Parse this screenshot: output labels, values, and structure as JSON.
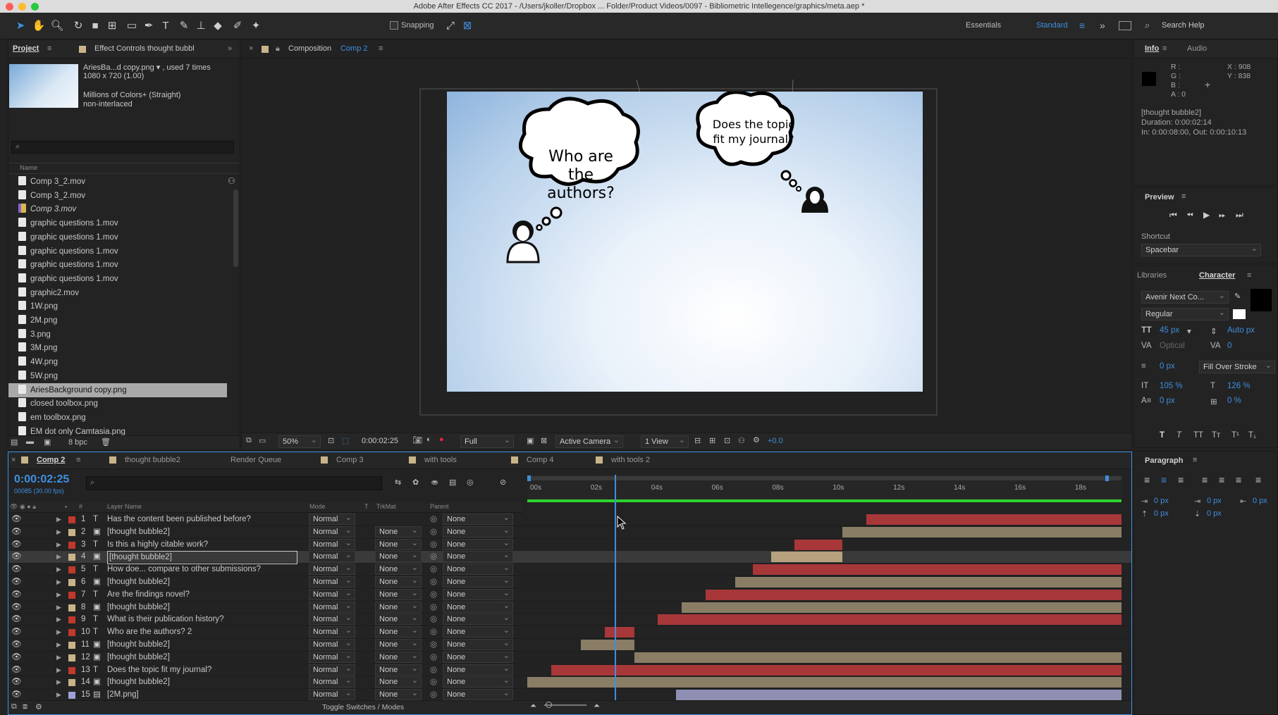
{
  "titlebar": {
    "title": "Adobe After Effects CC 2017 - /Users/jkoller/Dropbox ... Folder/Product Videos/0097 - Bibliometric Intellegence/graphics/meta.aep *"
  },
  "toolbar": {
    "snapping_label": "Snapping",
    "workspaces": [
      "Essentials",
      "Standard"
    ],
    "search_placeholder": "Search Help"
  },
  "project": {
    "tabs": [
      "Project",
      "Effect Controls thought bubbl"
    ],
    "preview_name": "AriesBa...d copy.png ▾ , used 7 times",
    "preview_size": "1080 x 720 (1.00)",
    "preview_colors": "Millions of Colors+ (Straight)",
    "preview_interlace": "non-interlaced",
    "name_header": "Name",
    "items": [
      "Comp 3_2.mov",
      "Comp 3_2.mov",
      "Comp 3.mov",
      "graphic questions 1.mov",
      "graphic questions 1.mov",
      "graphic questions 1.mov",
      "graphic questions 1.mov",
      "graphic questions 1.mov",
      "graphic2.mov",
      "1W.png",
      "2M.png",
      "3.png",
      "3M.png",
      "4W.png",
      "5W.png",
      "AriesBackground copy.png",
      "closed toolbox.png",
      "em toolbox.png",
      "EM dot only Camtasia.png"
    ],
    "bpc": "8 bpc"
  },
  "composition": {
    "tab_prefix": "Composition",
    "tab_name": "Comp 2",
    "bubble1": "Who are the authors?",
    "bubble2": "Does the topic fit my journal?",
    "zoom": "50%",
    "timecode": "0:00:02:25",
    "resolution": "Full",
    "camera": "Active Camera",
    "views": "1 View",
    "exposure": "+0.0"
  },
  "info": {
    "tabs": [
      "Info",
      "Audio"
    ],
    "r": "R :",
    "g": "G :",
    "b": "B :",
    "a": "A : 0",
    "x": "X : 908",
    "y": "Y : 838",
    "layer": "[thought bubble2]",
    "duration": "Duration: 0:00:02:14",
    "inout": "In: 0:00:08:00, Out: 0:00:10:13"
  },
  "preview": {
    "title": "Preview",
    "shortcut_label": "Shortcut",
    "shortcut_value": "Spacebar"
  },
  "character": {
    "tabs": [
      "Libraries",
      "Character"
    ],
    "font": "Avenir Next Co...",
    "style": "Regular",
    "size": "45 px",
    "leading": "Auto px",
    "kerning": "Optical",
    "tracking": "0",
    "stroke": "0 px",
    "stroke_mode": "Fill Over Stroke",
    "vscale": "105 %",
    "hscale": "126 %",
    "baseline": "0 px",
    "tsume": "0 %"
  },
  "paragraph": {
    "title": "Paragraph",
    "indent_values": [
      "0 px",
      "0 px",
      "0 px",
      "0 px",
      "0 px"
    ]
  },
  "timeline": {
    "tabs": [
      "Comp 2",
      "thought bubble2",
      "Render Queue",
      "Comp 3",
      "with tools",
      "Comp 4",
      "with tools 2"
    ],
    "timecode": "0:00:02:25",
    "frames": "00085 (30.00 fps)",
    "col_layer_name": "Layer Name",
    "col_mode": "Mode",
    "col_t": "T",
    "col_trkmat": "TrkMat",
    "col_parent": "Parent",
    "ruler": [
      "00s",
      "02s",
      "04s",
      "06s",
      "08s",
      "10s",
      "12s",
      "14s",
      "16s",
      "18s"
    ],
    "current_time_fraction": 0.15,
    "footer": "Toggle Switches / Modes",
    "layers": [
      {
        "num": "1",
        "name": "Has the content been published before?",
        "type": "T",
        "label": "#c0392b",
        "bar": "#a8373a",
        "start": 0.57,
        "end": 1.0
      },
      {
        "num": "2",
        "name": "[thought bubble2]",
        "type": "img",
        "label": "#c9b48a",
        "bar": "#8a7d66",
        "start": 0.53,
        "end": 1.0
      },
      {
        "num": "3",
        "name": "Is this a highly citable  work?",
        "type": "T",
        "label": "#c0392b",
        "bar": "#a8373a",
        "start": 0.45,
        "end": 0.53
      },
      {
        "num": "4",
        "name": "[thought bubble2]",
        "type": "img",
        "label": "#c9b48a",
        "bar": "#b5a17d",
        "start": 0.41,
        "end": 0.53
      },
      {
        "num": "5",
        "name": "How doe... compare to other  submissions?",
        "type": "T",
        "label": "#c0392b",
        "bar": "#a8373a",
        "start": 0.38,
        "end": 1.0
      },
      {
        "num": "6",
        "name": "[thought bubble2]",
        "type": "img",
        "label": "#c9b48a",
        "bar": "#8a7d66",
        "start": 0.35,
        "end": 1.0
      },
      {
        "num": "7",
        "name": "Are the findings novel?",
        "type": "T",
        "label": "#c0392b",
        "bar": "#a8373a",
        "start": 0.3,
        "end": 1.0
      },
      {
        "num": "8",
        "name": "[thought bubble2]",
        "type": "img",
        "label": "#c9b48a",
        "bar": "#8a7d66",
        "start": 0.26,
        "end": 1.0
      },
      {
        "num": "9",
        "name": "What is their publication history?",
        "type": "T",
        "label": "#c0392b",
        "bar": "#a8373a",
        "start": 0.22,
        "end": 1.0
      },
      {
        "num": "10",
        "name": "Who are  the authors? 2",
        "type": "T",
        "label": "#c0392b",
        "bar": "#a8373a",
        "start": 0.13,
        "end": 0.18
      },
      {
        "num": "11",
        "name": "[thought bubble2]",
        "type": "img",
        "label": "#c9b48a",
        "bar": "#8a7d66",
        "start": 0.09,
        "end": 0.18
      },
      {
        "num": "12",
        "name": "[thought bubble2]",
        "type": "img",
        "label": "#c9b48a",
        "bar": "#8a7d66",
        "start": 0.18,
        "end": 1.0
      },
      {
        "num": "13",
        "name": "Does the  topic fit  my journal?",
        "type": "T",
        "label": "#c0392b",
        "bar": "#a8373a",
        "start": 0.04,
        "end": 1.0
      },
      {
        "num": "14",
        "name": "[thought bubble2]",
        "type": "img",
        "label": "#c9b48a",
        "bar": "#8a7d66",
        "start": 0.0,
        "end": 1.0
      },
      {
        "num": "15",
        "name": "[2M.png]",
        "type": "file",
        "label": "#a0a0d8",
        "bar": "#8f8fb3",
        "start": 0.25,
        "end": 1.0
      }
    ],
    "mode_value": "Normal",
    "trkmat_value": "None",
    "parent_value": "None"
  }
}
